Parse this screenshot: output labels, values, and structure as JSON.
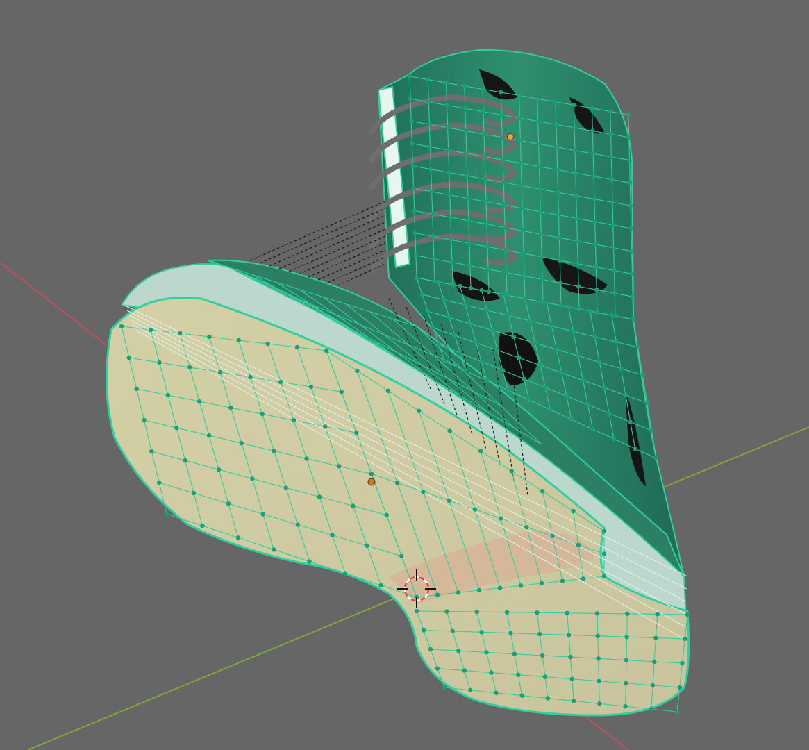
{
  "viewport": {
    "view": "3d-viewport",
    "mode": "edit-mode",
    "colors": {
      "background": "#666666",
      "x_axis": "#c0505e",
      "y_axis": "#7fa83a",
      "wire": "#2fcf9e",
      "vertex": "#1a9f78",
      "sole": "#d2cfa6",
      "body": "#2c8a6d",
      "lace": "#6e6e6e",
      "cursor_red": "#e0433b"
    }
  },
  "icons": {
    "cursor": "3d-cursor-icon",
    "origin": "object-origin-icon",
    "light": "light-origin-icon"
  }
}
